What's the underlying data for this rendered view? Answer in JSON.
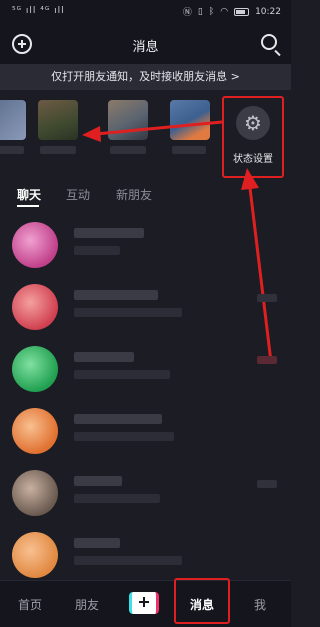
{
  "status_bar": {
    "signal_text": "⁵ᴳ ıll ⁴ᴳ ıll",
    "icons": [
      "nfc-icon",
      "vibrate-icon",
      "bluetooth-icon",
      "wifi-icon",
      "battery-icon"
    ],
    "time": "10:22"
  },
  "header": {
    "title": "消息",
    "left_icon": "add-friend-icon",
    "right_icon": "search-icon"
  },
  "notice": {
    "text": "仅打开朋友通知，及时接收朋友消息 >"
  },
  "status_setting": {
    "icon": "gear-icon",
    "label": "状态设置"
  },
  "tabs": [
    {
      "label": "聊天",
      "active": true
    },
    {
      "label": "互动",
      "active": false
    },
    {
      "label": "新朋友",
      "active": false
    }
  ],
  "bottom_nav": {
    "items": [
      {
        "label": "首页",
        "active": false
      },
      {
        "label": "朋友",
        "active": false
      },
      {
        "label": "消息",
        "active": true
      },
      {
        "label": "我",
        "active": false
      }
    ],
    "add_icon": "plus-icon"
  },
  "colors": {
    "background": "#1b1c24",
    "header": "#15161d",
    "annotation_red": "#e02020",
    "accent_cyan": "#3ce0e6",
    "accent_pink": "#f0306a"
  }
}
